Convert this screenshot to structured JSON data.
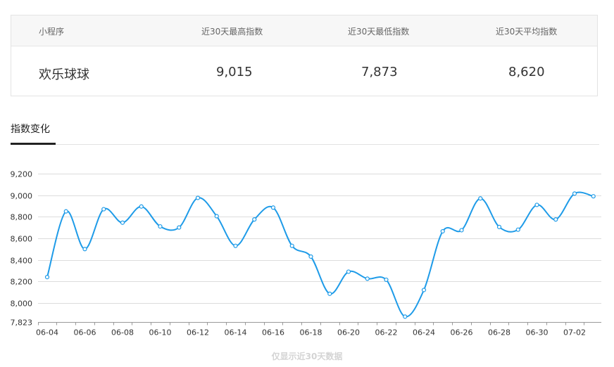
{
  "summary": {
    "headers": [
      "小程序",
      "近30天最高指数",
      "近30天最低指数",
      "近30天平均指数"
    ],
    "values": [
      "欢乐球球",
      "9,015",
      "7,873",
      "8,620"
    ]
  },
  "section": {
    "title": "指数变化"
  },
  "footnote": "仅显示近30天数据",
  "colors": {
    "line": "#1e9be8",
    "grid": "#dcdcdc",
    "axis": "#333333"
  },
  "chart_data": {
    "type": "line",
    "title": "",
    "xlabel": "",
    "ylabel": "",
    "ylim": [
      7823,
      9200
    ],
    "y_ticks": [
      9200,
      9000,
      8800,
      8600,
      8400,
      8200,
      8000,
      7823
    ],
    "y_tick_labels": [
      "9,200",
      "9,000",
      "8,800",
      "8,600",
      "8,400",
      "8,200",
      "8,000",
      "7,823"
    ],
    "x": [
      "06-04",
      "06-05",
      "06-06",
      "06-07",
      "06-08",
      "06-09",
      "06-10",
      "06-11",
      "06-12",
      "06-13",
      "06-14",
      "06-15",
      "06-16",
      "06-17",
      "06-18",
      "06-19",
      "06-20",
      "06-21",
      "06-22",
      "06-23",
      "06-24",
      "06-25",
      "06-26",
      "06-27",
      "06-28",
      "06-29",
      "06-30",
      "07-01",
      "07-02",
      "07-03"
    ],
    "x_tick_labels": [
      "06-04",
      "06-06",
      "06-08",
      "06-10",
      "06-12",
      "06-14",
      "06-16",
      "06-18",
      "06-20",
      "06-22",
      "06-24",
      "06-26",
      "06-28",
      "06-30",
      "07-02"
    ],
    "series": [
      {
        "values": [
          8240,
          8850,
          8500,
          8870,
          8745,
          8895,
          8710,
          8700,
          8975,
          8805,
          8530,
          8775,
          8885,
          8530,
          8430,
          8085,
          8290,
          8225,
          8215,
          7873,
          8120,
          8665,
          8675,
          8970,
          8705,
          8680,
          8910,
          8775,
          9015,
          8990
        ]
      }
    ],
    "grid": true,
    "legend": "none"
  }
}
